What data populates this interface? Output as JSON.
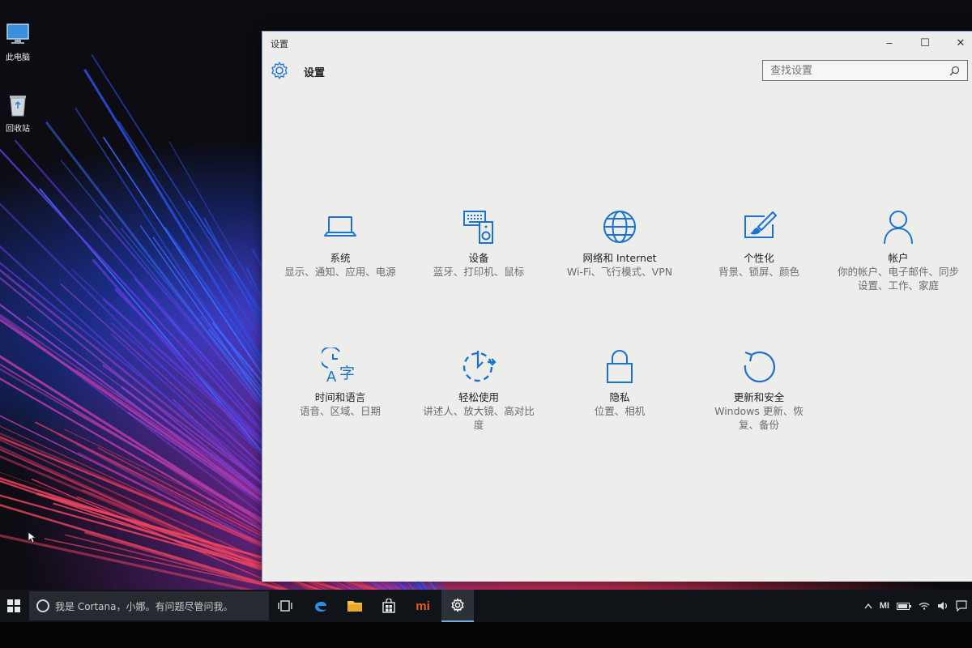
{
  "desktop": {
    "icons": [
      {
        "label": "此电脑",
        "icon": "computer-icon"
      },
      {
        "label": "回收站",
        "icon": "recycle-bin-icon"
      }
    ]
  },
  "window": {
    "title": "设置",
    "controls": {
      "minimize": "‒",
      "maximize": "☐",
      "close": "✕"
    }
  },
  "header": {
    "title": "设置",
    "search_placeholder": "查找设置",
    "accent_color": "#1a72d1"
  },
  "categories": [
    {
      "icon": "laptop-icon",
      "title": "系统",
      "desc": "显示、通知、应用、电源"
    },
    {
      "icon": "devices-icon",
      "title": "设备",
      "desc": "蓝牙、打印机、鼠标"
    },
    {
      "icon": "globe-icon",
      "title": "网络和 Internet",
      "desc": "Wi-Fi、飞行模式、VPN"
    },
    {
      "icon": "personalization-icon",
      "title": "个性化",
      "desc": "背景、锁屏、颜色"
    },
    {
      "icon": "person-icon",
      "title": "帐户",
      "desc": "你的帐户、电子邮件、同步设置、工作、家庭"
    },
    {
      "icon": "time-language-icon",
      "title": "时间和语言",
      "desc": "语音、区域、日期"
    },
    {
      "icon": "ease-of-access-icon",
      "title": "轻松使用",
      "desc": "讲述人、放大镜、高对比度"
    },
    {
      "icon": "lock-icon",
      "title": "隐私",
      "desc": "位置、相机"
    },
    {
      "icon": "update-icon",
      "title": "更新和安全",
      "desc": "Windows 更新、恢复、备份"
    }
  ],
  "taskbar": {
    "cortana_text": "我是 Cortana，小娜。有问题尽管问我。",
    "apps": [
      {
        "name": "task-view-icon"
      },
      {
        "name": "edge-icon"
      },
      {
        "name": "file-explorer-icon"
      },
      {
        "name": "store-icon"
      },
      {
        "name": "mi-icon",
        "label": "mi"
      },
      {
        "name": "settings-icon",
        "active": true
      }
    ],
    "tray": {
      "mi_label": "MI"
    }
  }
}
